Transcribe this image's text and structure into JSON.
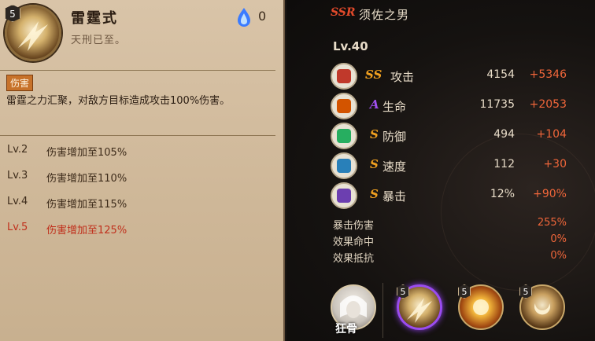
{
  "skill": {
    "name": "雷霆式",
    "subtitle": "天刑已至。",
    "level_badge": "5",
    "orb_count": "0",
    "tag": "伤害",
    "description": "雷霆之力汇聚，对敌方目标造成攻击100%伤害。",
    "levels": [
      {
        "lv": "Lv.2",
        "text": "伤害增加至105%",
        "active": false
      },
      {
        "lv": "Lv.3",
        "text": "伤害增加至110%",
        "active": false
      },
      {
        "lv": "Lv.4",
        "text": "伤害增加至115%",
        "active": false
      },
      {
        "lv": "Lv.5",
        "text": "伤害增加至125%",
        "active": true
      }
    ]
  },
  "hero": {
    "rarity": "SSR",
    "name": "须佐之男",
    "level": "Lv.40"
  },
  "stats": [
    {
      "grade": "SS",
      "label": "攻击",
      "value": "4154",
      "bonus": "+5346",
      "grade_color": "#f0a020",
      "icon_color": "#c0392b",
      "icon": "attack-icon"
    },
    {
      "grade": "A",
      "label": "生命",
      "value": "11735",
      "bonus": "+2053",
      "grade_color": "#a050f0",
      "icon_color": "#d35400",
      "icon": "life-icon"
    },
    {
      "grade": "S",
      "label": "防御",
      "value": "494",
      "bonus": "+104",
      "grade_color": "#f0a020",
      "icon_color": "#27ae60",
      "icon": "defense-icon"
    },
    {
      "grade": "S",
      "label": "速度",
      "value": "112",
      "bonus": "+30",
      "grade_color": "#f0a020",
      "icon_color": "#2980b9",
      "icon": "speed-icon"
    },
    {
      "grade": "S",
      "label": "暴击",
      "value": "12%",
      "bonus": "+90%",
      "grade_color": "#f0a020",
      "icon_color": "#6c3fb0",
      "icon": "crit-icon"
    }
  ],
  "sub_stats": [
    {
      "label": "暴击伤害",
      "value": "255%"
    },
    {
      "label": "效果命中",
      "value": "0%"
    },
    {
      "label": "效果抵抗",
      "value": "0%"
    }
  ],
  "bottom": {
    "avatar_label": "狂骨",
    "slots": [
      "5",
      "5",
      "5"
    ]
  }
}
